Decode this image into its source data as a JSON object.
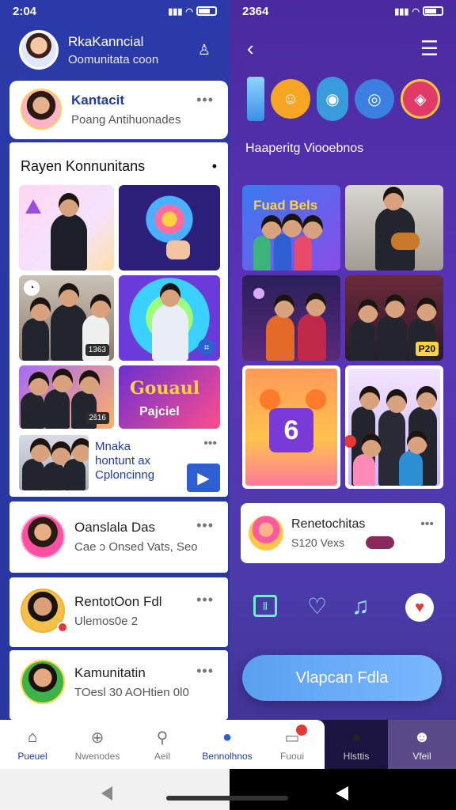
{
  "left_status": {
    "time": "2:04"
  },
  "right_status": {
    "time": "2364"
  },
  "left_header": {
    "name": "RkaKanncial",
    "subtitle": "Oomunitata coon"
  },
  "top_card": {
    "name": "Kantacit",
    "subtitle": "Poang Antihuonades"
  },
  "section": {
    "title": "Rayen Konnunitans"
  },
  "tiles_left": [
    {
      "tag": ""
    },
    {
      "tag": ""
    },
    {
      "tag": "1363"
    },
    {
      "tag": ""
    },
    {
      "tag": "2ŝ16"
    },
    {
      "title": "Gouaul",
      "sub": "Pajciel"
    }
  ],
  "media_item": {
    "line1": "Mnaka",
    "line2": "hontunt ax",
    "line3": "Cploncinng"
  },
  "list_items": [
    {
      "name": "Oanslala Das",
      "detail": "Cae ɔ Onsed Vats, Seo"
    },
    {
      "name": "RentotOon Fdl",
      "detail": "Ulemos0e 2"
    },
    {
      "name": "Kamunitatin",
      "detail": "TOesl 30 AOHtien 0l0"
    }
  ],
  "nav": [
    {
      "label": "Pueuel",
      "icon": "home-icon"
    },
    {
      "label": "Nwenodes",
      "icon": "plus-circle-icon"
    },
    {
      "label": "Aeil",
      "icon": "search-icon"
    },
    {
      "label": "Bennolhnos",
      "icon": "chat-icon"
    },
    {
      "label": "Fuoui",
      "icon": "inbox-icon"
    },
    {
      "label": "Hlsttis",
      "icon": "cat-icon"
    },
    {
      "label": "Vfeil",
      "icon": "person-icon"
    }
  ],
  "right": {
    "section_title": "Haaperitg Viooebnos",
    "tiles": [
      {
        "title": "Fuad Bels"
      },
      {
        "title": ""
      },
      {
        "title": ""
      },
      {
        "tag": "P20"
      },
      {
        "badge": "6"
      },
      {
        "title": ""
      }
    ],
    "promo": {
      "name": "Renetochitas",
      "detail": "S120 Vexs"
    },
    "cta": "Vlapcan Fdla"
  },
  "colors": {
    "accent": "#2a3aa8",
    "purple": "#5a34b8",
    "cta": "#5aa0f0"
  }
}
